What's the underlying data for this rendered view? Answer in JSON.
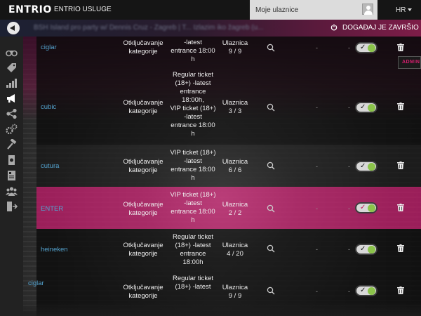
{
  "topbar": {
    "logo": "ENTRIO",
    "services_link": "ENTRIO USLUGE",
    "user_label": "Moje ulaznice",
    "language": "HR"
  },
  "titlebar": {
    "event_title": "BSH Island pro party w/ Dennis Cruz - Zagreb | T... Izlazim iko žagreb (u...",
    "finished_label": "DOGAĐAJ JE ZAVRŠIO"
  },
  "sidebar": {
    "icons": [
      "binoculars-icon",
      "tag-icon",
      "bar-chart-icon",
      "megaphone-icon",
      "share-icon",
      "gears-icon",
      "hammer-icon",
      "ticket-icon",
      "id-card-icon",
      "users-icon",
      "exit-icon"
    ]
  },
  "admin_badge": "ADMIN",
  "rows": [
    {
      "name": "ciglar",
      "category": [
        "Otključavanje",
        "kategorije"
      ],
      "tickets": [
        "-latest",
        "entrance 18:00",
        "h"
      ],
      "scan": [
        "Ulaznica",
        "9 / 9"
      ],
      "dash1": "-",
      "dash2": "-",
      "enabled": true
    },
    {
      "name": "cubic",
      "category": [
        "Otključavanje",
        "kategorije"
      ],
      "tickets": [
        "Regular ticket",
        "(18+) -latest",
        "entrance",
        "18:00h,",
        "VIP ticket (18+)",
        "-latest",
        "entrance 18:00",
        "h"
      ],
      "scan": [
        "Ulaznica",
        "3 / 3"
      ],
      "dash1": "-",
      "dash2": "-",
      "enabled": true
    },
    {
      "name": "cutura",
      "category": [
        "Otključavanje",
        "kategorije"
      ],
      "tickets": [
        "VIP ticket (18+)",
        "-latest",
        "entrance 18:00",
        "h"
      ],
      "scan": [
        "Ulaznica",
        "6 / 6"
      ],
      "dash1": "-",
      "dash2": "-",
      "enabled": true
    },
    {
      "name": "ENTER",
      "category": [
        "Otključavanje",
        "kategorije"
      ],
      "tickets": [
        "VIP ticket (18+)",
        "-latest",
        "entrance 18:00",
        "h"
      ],
      "scan": [
        "Ulaznica",
        "2 / 2"
      ],
      "dash1": "-",
      "dash2": "-",
      "enabled": true
    },
    {
      "name": "heineken",
      "category": [
        "Otključavanje",
        "kategorije"
      ],
      "tickets": [
        "Regular ticket",
        "(18+) -latest",
        "entrance",
        "18:00h"
      ],
      "scan": [
        "Ulaznica",
        "4 / 20"
      ],
      "dash1": "-",
      "dash2": "-",
      "enabled": true
    },
    {
      "name": "ciglar",
      "category": [
        "Otključavanje",
        "kategorije"
      ],
      "tickets": [
        "Regular ticket",
        "(18+) -latest"
      ],
      "scan": [
        "Ulaznica",
        "9 / 9"
      ],
      "dash1": "-",
      "dash2": "-",
      "enabled": true
    }
  ],
  "colors": {
    "accent": "#d51e6e",
    "link": "#54a3cf",
    "toggle_on": "#8bc34a"
  }
}
